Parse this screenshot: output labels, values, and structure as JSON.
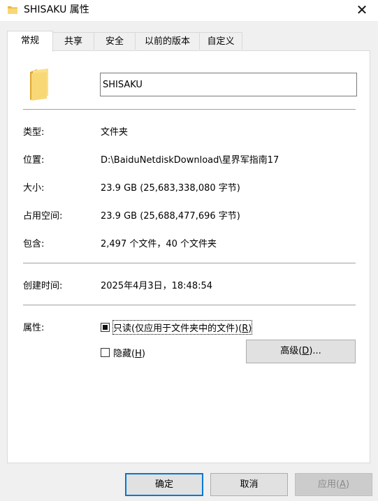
{
  "window": {
    "title": "SHISAKU 属性",
    "close_symbol": "✕"
  },
  "tabs": [
    {
      "label": "常规",
      "active": true
    },
    {
      "label": "共享",
      "active": false
    },
    {
      "label": "安全",
      "active": false
    },
    {
      "label": "以前的版本",
      "active": false
    },
    {
      "label": "自定义",
      "active": false
    }
  ],
  "general": {
    "folder_name": "SHISAKU",
    "type_label": "类型:",
    "type_value": "文件夹",
    "location_label": "位置:",
    "location_value": "D:\\BaiduNetdiskDownload\\星界军指南17",
    "size_label": "大小:",
    "size_value": "23.9 GB (25,683,338,080 字节)",
    "size_on_disk_label": "占用空间:",
    "size_on_disk_value": "23.9 GB (25,688,477,696 字节)",
    "contains_label": "包含:",
    "contains_value": "2,497 个文件，40 个文件夹",
    "created_label": "创建时间:",
    "created_value": "2025年4月3日，18:48:54",
    "attributes_label": "属性:",
    "readonly": {
      "label_main": "只读(仅应用于文件夹中的文件)(",
      "mnemonic": "R",
      "label_end": ")",
      "state": "indeterminate"
    },
    "hidden": {
      "label_main": "隐藏(",
      "mnemonic": "H",
      "label_end": ")",
      "checked": false
    },
    "advanced": {
      "label_main": "高级(",
      "mnemonic": "D",
      "label_end": ")..."
    }
  },
  "footer": {
    "ok_label": "确定",
    "cancel_label": "取消",
    "apply_main": "应用(",
    "apply_mnemonic": "A",
    "apply_end": ")"
  },
  "colors": {
    "folder_yellow": "#f8d775",
    "default_button_border": "#0078d7"
  },
  "icons": {
    "title": "folder-icon",
    "big": "folder-icon",
    "close": "close-icon"
  }
}
